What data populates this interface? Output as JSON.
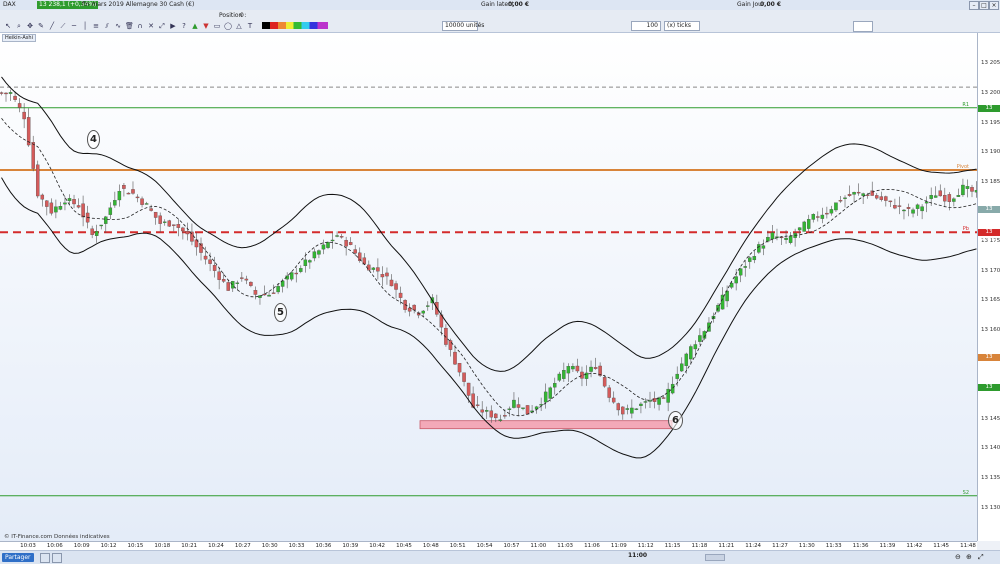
{
  "window": {
    "instrument_label": "DAX",
    "price_badge": "13 238,1 (+0,34%)",
    "contract": "fin mars 2019 Allemagne 30 Cash (€)",
    "gain_latent_label": "Gain latent :",
    "gain_latent_value": "0,00 €",
    "gain_jour_label": "Gain Jour :",
    "gain_jour_value": "0,00 €"
  },
  "toolbar": {
    "position_label": "Position :",
    "position_value": "0",
    "units_value": "10000 unités",
    "ticks_value": "100",
    "ticks_unit": "(x) ticks"
  },
  "chart": {
    "instrument_tab": "Heikin-Ashi",
    "source": "© IT-Finance.com Données indicatives",
    "annotations": [
      "4",
      "5",
      "6"
    ],
    "colors": {
      "bull": "#33b533",
      "bear": "#d45b5b",
      "bull_fill": "#8fcf9f",
      "bear_fill": "#c98b8b",
      "support_zone": "#f3a9b8"
    },
    "levels": [
      {
        "label": "R1",
        "price": 13197.5,
        "value_label": "13 197,5",
        "color": "#2e9b2e"
      },
      {
        "label": "Pivot",
        "price": 13187,
        "value_label": "",
        "color": "#d8843a"
      },
      {
        "label": "Pb",
        "price": 13176.5,
        "value_label": "13 176,5",
        "color": "#d42b2b"
      },
      {
        "label": "S2",
        "price": 13132,
        "value_label": "",
        "color": "#2e9b2e"
      }
    ],
    "dashed_level": {
      "price": 13201,
      "label": "13 201,0"
    },
    "axis_labels": {
      "current_price": "13 180,5",
      "mid_marker_a": "13 155,4",
      "mid_marker_b": "13 150,4"
    }
  },
  "chart_data": {
    "type": "candlestick",
    "ylim": [
      13130,
      13210
    ],
    "yticks": [
      "13 205",
      "13 200",
      "13 195",
      "13 190",
      "13 185",
      "13 180",
      "13 175",
      "13 170",
      "13 165",
      "13 160",
      "13 155",
      "13 150",
      "13 145",
      "13 140",
      "13 135",
      "13 130"
    ],
    "xticks": [
      "10:03",
      "10:06",
      "10:09",
      "10:12",
      "10:15",
      "10:18",
      "10:21",
      "10:24",
      "10:27",
      "10:30",
      "10:33",
      "10:36",
      "10:39",
      "10:42",
      "10:45",
      "10:48",
      "10:51",
      "10:54",
      "10:57",
      "11:00",
      "11:03",
      "11:06",
      "11:09",
      "11:12",
      "11:15",
      "11:18",
      "11:21",
      "11:24",
      "11:27",
      "11:30",
      "11:33",
      "11:36",
      "11:39",
      "11:42",
      "11:45",
      "11:48"
    ],
    "price_path": [
      13200,
      13196,
      13183,
      13180,
      13182,
      13181,
      13176,
      13179,
      13184,
      13183,
      13181,
      13178,
      13178,
      13176,
      13173,
      13170,
      13167,
      13169,
      13166,
      13166,
      13168,
      13170,
      13172,
      13174,
      13176,
      13174,
      13171,
      13170,
      13168,
      13164,
      13163,
      13165,
      13158,
      13153,
      13147,
      13146,
      13145,
      13148,
      13146,
      13148,
      13151,
      13154,
      13152,
      13154,
      13149,
      13146,
      13147,
      13148,
      13148,
      13153,
      13157,
      13160,
      13164,
      13168,
      13171,
      13174,
      13176,
      13175,
      13177,
      13179,
      13180,
      13182,
      13183,
      13183,
      13182,
      13181,
      13180,
      13181,
      13183,
      13182,
      13184,
      13183
    ],
    "series": []
  },
  "statusbar": {
    "share_label": "Partager",
    "time": "11:00"
  }
}
